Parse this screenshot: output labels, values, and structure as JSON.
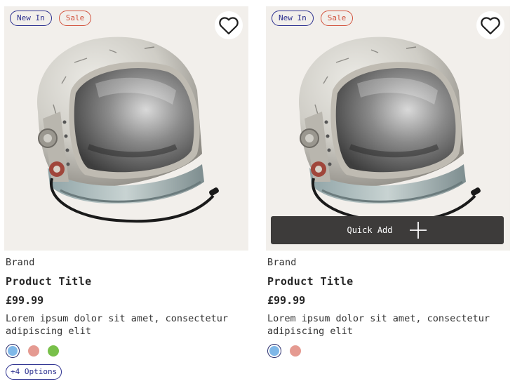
{
  "products": [
    {
      "badges": {
        "new": "New In",
        "sale": "Sale"
      },
      "wishlist_icon": "heart-icon",
      "brand": "Brand",
      "title": "Product Title",
      "price": "£99.99",
      "description": "Lorem ipsum dolor sit amet, consectetur adipiscing elit",
      "swatches": [
        {
          "color": "#7fb8e8",
          "selected": true
        },
        {
          "color": "#e59a91",
          "selected": false
        },
        {
          "color": "#78c04a",
          "selected": false
        }
      ],
      "more_options": "+4 Options"
    },
    {
      "badges": {
        "new": "New In",
        "sale": "Sale"
      },
      "wishlist_icon": "heart-icon",
      "brand": "Brand",
      "title": "Product Title",
      "price": "£99.99",
      "description": "Lorem ipsum dolor sit amet, consectetur adipiscing elit",
      "quick_add": {
        "label": "Quick Add",
        "icon": "plus-icon"
      },
      "swatches": [
        {
          "color": "#7fb8e8",
          "selected": true
        },
        {
          "color": "#e59a91",
          "selected": false
        }
      ]
    }
  ],
  "colors": {
    "badge_new": "#2b2f8f",
    "badge_sale": "#d2533e",
    "media_bg": "#f2efeb",
    "quick_add_bg": "#3d3b3a"
  }
}
